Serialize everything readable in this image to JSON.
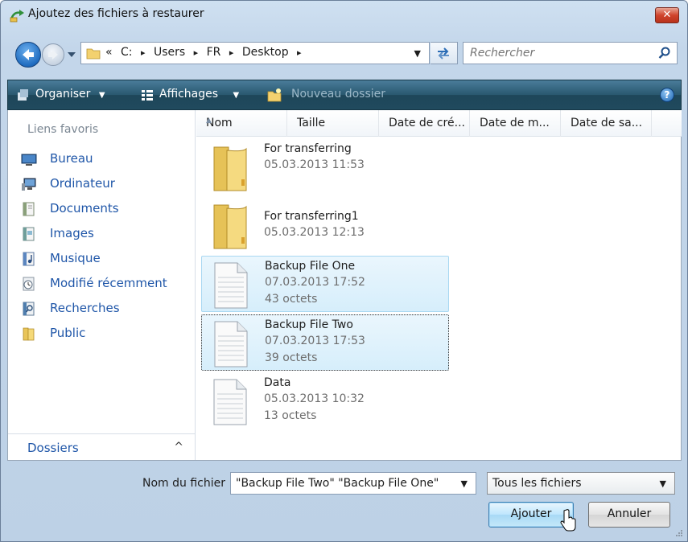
{
  "window": {
    "title": "Ajoutez des fichiers à restaurer",
    "close_label": "✕"
  },
  "address": {
    "path": [
      "«",
      "C:",
      "▸",
      "Users",
      "▸",
      "FR",
      "▸",
      "Desktop",
      "▸"
    ],
    "search_placeholder": "Rechercher"
  },
  "toolbar": {
    "organize": "Organiser",
    "views": "Affichages",
    "new_folder": "Nouveau dossier",
    "help": "?"
  },
  "nav": {
    "favorites_header": "Liens favoris",
    "items": [
      {
        "label": "Bureau",
        "icon": "desktop-icon"
      },
      {
        "label": "Ordinateur",
        "icon": "computer-icon"
      },
      {
        "label": "Documents",
        "icon": "documents-icon"
      },
      {
        "label": "Images",
        "icon": "pictures-icon"
      },
      {
        "label": "Musique",
        "icon": "music-icon"
      },
      {
        "label": "Modifié récemment",
        "icon": "recent-icon"
      },
      {
        "label": "Recherches",
        "icon": "searches-icon"
      },
      {
        "label": "Public",
        "icon": "folder-icon"
      }
    ],
    "folders_label": "Dossiers",
    "folders_chevron": "^"
  },
  "columns": [
    "Nom",
    "Taille",
    "Date de cré...",
    "Date de m...",
    "Date de sa..."
  ],
  "files": [
    {
      "name": "For transferring",
      "date": "05.03.2013 11:53",
      "size": "",
      "type": "folder"
    },
    {
      "name": "For transferring1",
      "date": "05.03.2013 12:13",
      "size": "",
      "type": "folder"
    },
    {
      "name": "Backup File One",
      "date": "07.03.2013 17:52",
      "size": "43 octets",
      "type": "file"
    },
    {
      "name": "Backup File Two",
      "date": "07.03.2013 17:53",
      "size": "39 octets",
      "type": "file"
    },
    {
      "name": "Data",
      "date": "05.03.2013 10:32",
      "size": "13 octets",
      "type": "file"
    }
  ],
  "footer": {
    "filename_label": "Nom du fichier :",
    "filename_value": "\"Backup File Two\" \"Backup File One\"",
    "filetype_value": "Tous les fichiers",
    "add_button": "Ajouter",
    "cancel_button": "Annuler"
  },
  "colors": {
    "link": "#1f56a8",
    "toolbar": "#29586f",
    "selection": "#d6eefb"
  }
}
